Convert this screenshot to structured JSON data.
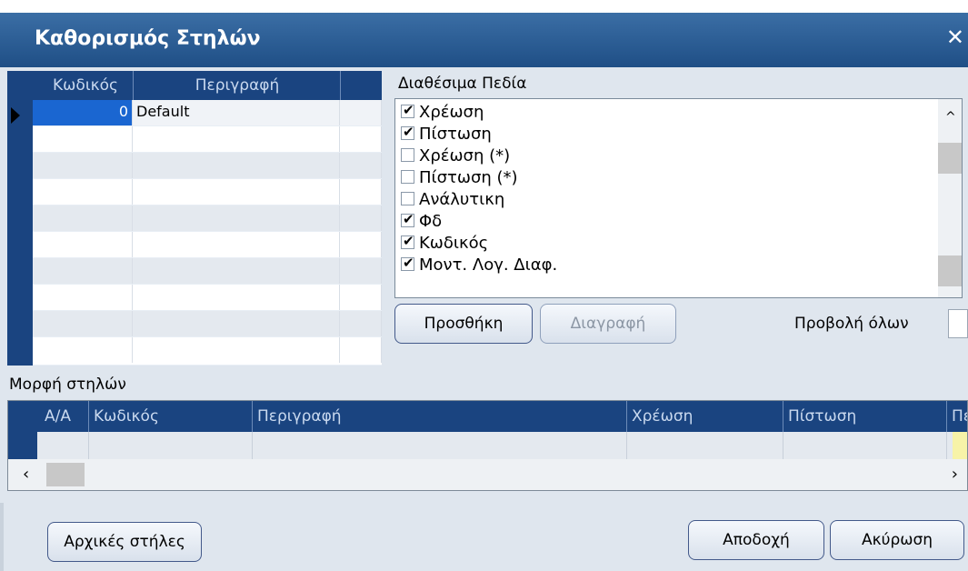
{
  "window": {
    "title": "Καθορισμός Στηλών",
    "close_glyph": "✕"
  },
  "left_grid": {
    "columns": [
      "Κωδικός",
      "Περιγραφή"
    ],
    "rows": [
      {
        "code": "0",
        "description": "Default"
      },
      {
        "code": "",
        "description": ""
      },
      {
        "code": "",
        "description": ""
      },
      {
        "code": "",
        "description": ""
      },
      {
        "code": "",
        "description": ""
      },
      {
        "code": "",
        "description": ""
      },
      {
        "code": "",
        "description": ""
      },
      {
        "code": "",
        "description": ""
      },
      {
        "code": "",
        "description": ""
      },
      {
        "code": "",
        "description": ""
      }
    ]
  },
  "available_fields": {
    "label": "Διαθέσιμα Πεδία",
    "items": [
      {
        "label": "Χρέωση",
        "checked": true
      },
      {
        "label": "Πίστωση",
        "checked": true
      },
      {
        "label": "Χρέωση (*)",
        "checked": false
      },
      {
        "label": "Πίστωση (*)",
        "checked": false
      },
      {
        "label": "Ανάλυτικη",
        "checked": false
      },
      {
        "label": "Φδ",
        "checked": true
      },
      {
        "label": "Κωδικός",
        "checked": true
      },
      {
        "label": "Μοντ. Λογ. Διαφ.",
        "checked": true
      }
    ]
  },
  "buttons": {
    "add": "Προσθήκη",
    "delete": "Διαγραφή",
    "initial_columns": "Αρχικές στήλες",
    "accept": "Αποδοχή",
    "cancel": "Ακύρωση"
  },
  "show_all_label": "Προβολή όλων",
  "column_format": {
    "label": "Μορφή στηλών",
    "columns": [
      "Α/Α",
      "Κωδικός",
      "Περιγραφή",
      "Χρέωση",
      "Πίστωση",
      "Πε"
    ]
  },
  "colors": {
    "grid_header": "#1a4480",
    "title_bar": "#2c5f97",
    "selected_cell": "#1a66d1"
  }
}
